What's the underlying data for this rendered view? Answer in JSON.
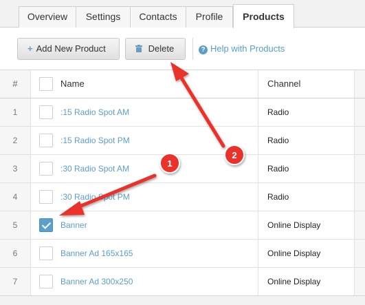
{
  "tabs": [
    {
      "label": "Overview"
    },
    {
      "label": "Settings"
    },
    {
      "label": "Contacts"
    },
    {
      "label": "Profile"
    },
    {
      "label": "Products",
      "active": true
    }
  ],
  "toolbar": {
    "add_icon": "+",
    "add_label": "Add New Product",
    "delete_icon": "trash-icon",
    "delete_label": "Delete",
    "help_icon": "?",
    "help_label": "Help with Products"
  },
  "grid": {
    "columns": {
      "num": "#",
      "name": "Name",
      "channel": "Channel"
    },
    "rows": [
      {
        "num": "1",
        "name": ":15 Radio Spot AM",
        "channel": "Radio",
        "checked": false
      },
      {
        "num": "2",
        "name": ":15 Radio Spot PM",
        "channel": "Radio",
        "checked": false
      },
      {
        "num": "3",
        "name": ":30 Radio Spot AM",
        "channel": "Radio",
        "checked": false
      },
      {
        "num": "4",
        "name": ":30 Radio Spot PM",
        "channel": "Radio",
        "checked": false
      },
      {
        "num": "5",
        "name": "Banner",
        "channel": "Online Display",
        "checked": true
      },
      {
        "num": "6",
        "name": "Banner Ad 165x165",
        "channel": "Online Display",
        "checked": false
      },
      {
        "num": "7",
        "name": "Banner Ad 300x250",
        "channel": "Online Display",
        "checked": false
      }
    ]
  },
  "annotations": {
    "step1": "1",
    "step2": "2",
    "color": "#e8322b"
  }
}
